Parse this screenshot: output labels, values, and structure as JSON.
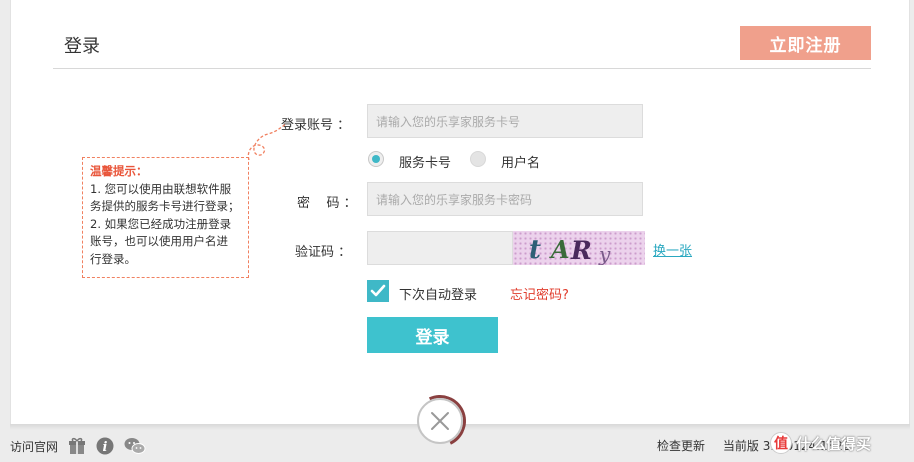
{
  "header": {
    "title": "登录",
    "register_label": "立即注册"
  },
  "form": {
    "account_label": "登录账号 ：",
    "account_placeholder": "请输入您的乐享家服务卡号",
    "account_type_options": [
      "服务卡号",
      "用户名"
    ],
    "account_type_selected": "服务卡号",
    "password_label": "密    码 ：",
    "password_placeholder": "请输入您的乐享家服务卡密码",
    "captcha_label": "验证码 ：",
    "captcha_text": "tARy",
    "refresh_captcha_label": "换一张",
    "auto_login_label": "下次自动登录",
    "auto_login_checked": true,
    "forgot_password_label": "忘记密码?",
    "login_label": "登录"
  },
  "tip": {
    "title": "温馨提示：",
    "lines": [
      "1. 您可以使用由联想软件服",
      "务提供的服务卡号进行登录；",
      "2. 如果您已经成功注册登录",
      "账号，也可以使用用户名进",
      "行登录。"
    ]
  },
  "footer": {
    "official_site_label": "访问官网",
    "check_update_label": "检查更新",
    "version_label": "当前版",
    "version_value": "3.1.0124.1822"
  },
  "watermark": {
    "text": "什么值得买",
    "logo_glyph": "值"
  },
  "colors": {
    "accent": "#3ec2ce",
    "register": "#f0a08c",
    "tip_border": "#f08060",
    "forgot": "#e03c2c"
  },
  "icons": [
    "gift-icon",
    "info-icon",
    "wechat-icon",
    "close-icon",
    "check-icon",
    "curl-decoration-icon"
  ]
}
